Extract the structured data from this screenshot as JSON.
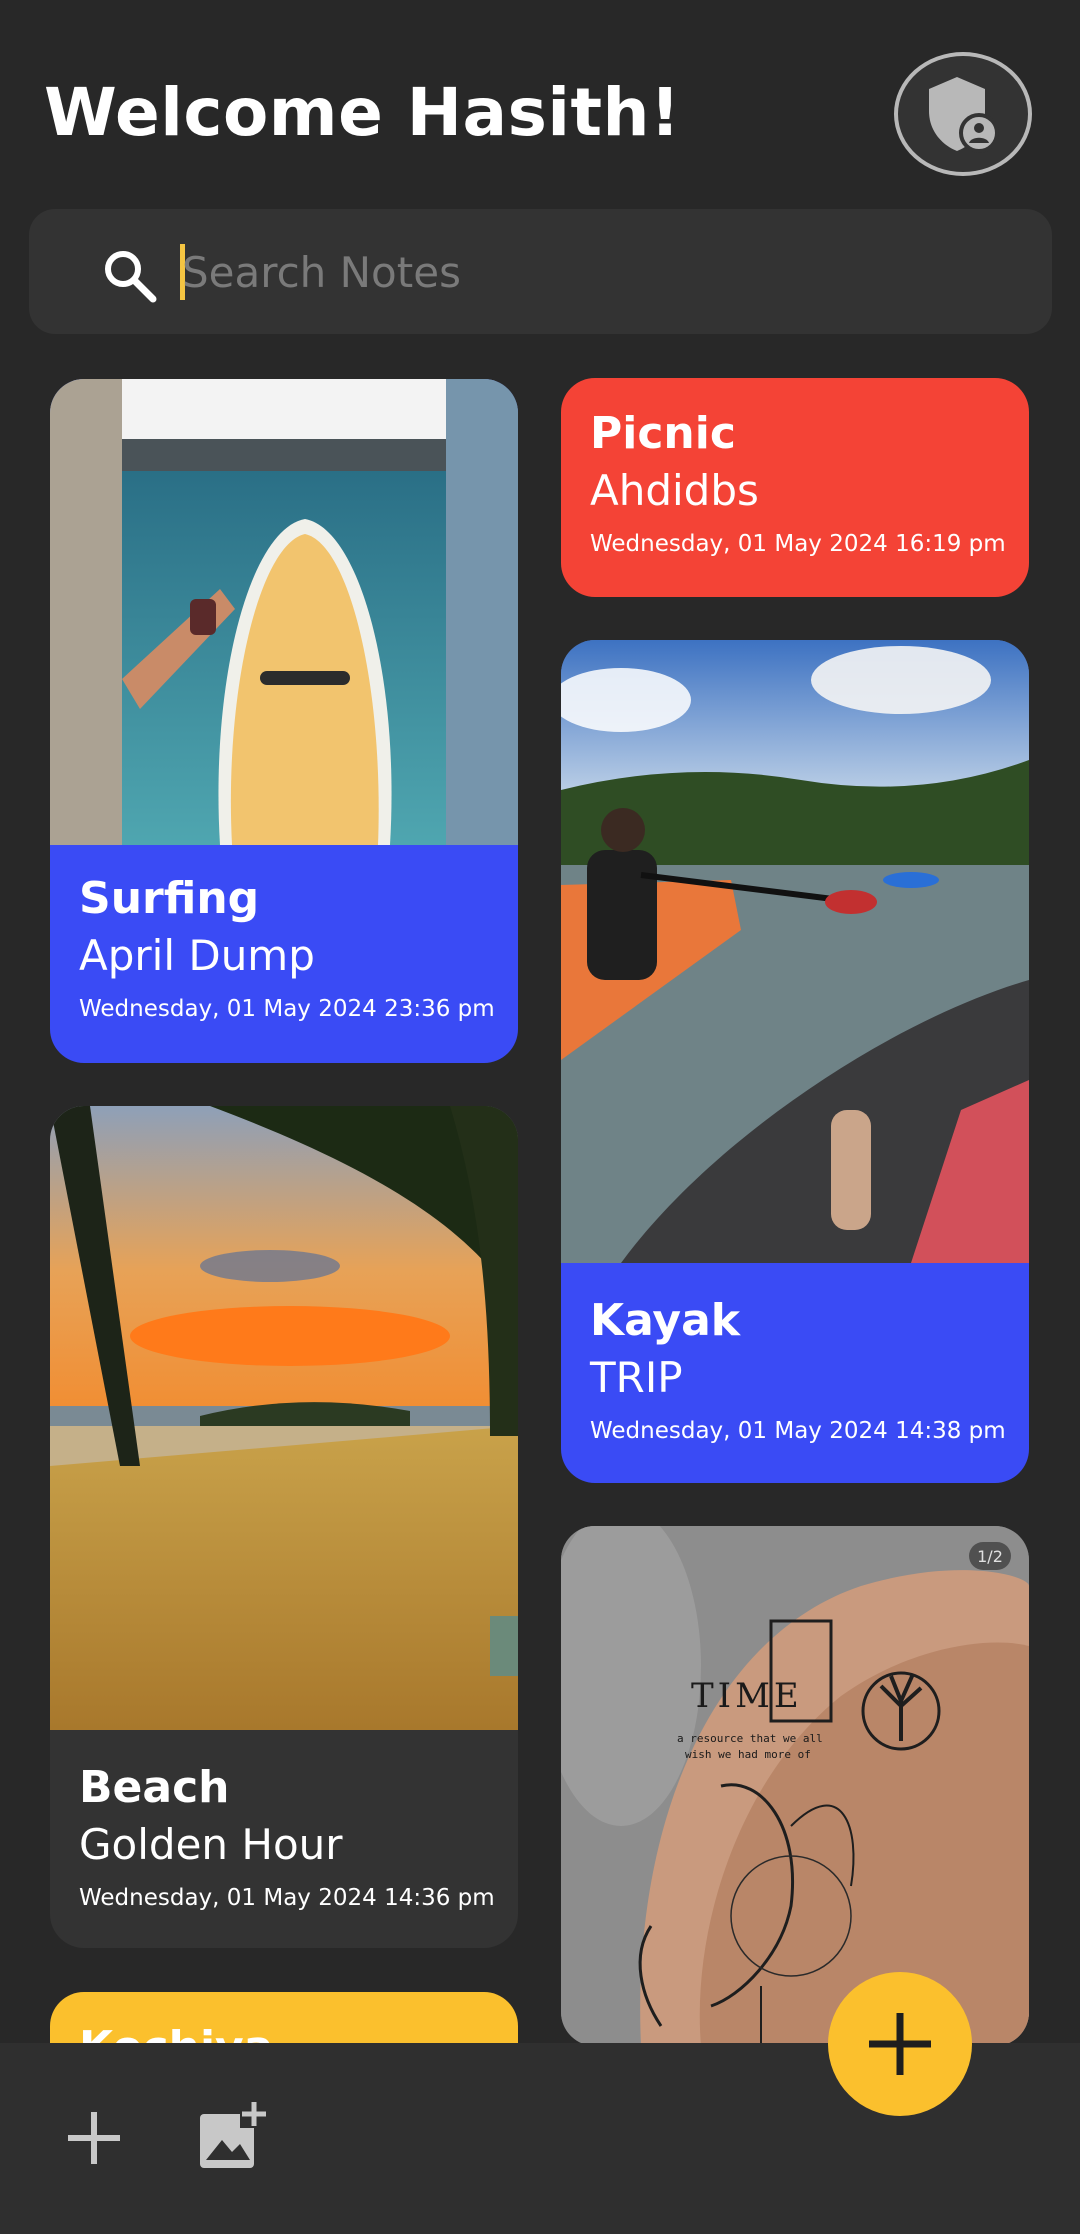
{
  "header": {
    "title": "Welcome Hasith!",
    "profile_icon": "shield-user-icon"
  },
  "search": {
    "placeholder": "Search Notes",
    "value": "",
    "icon": "search-icon"
  },
  "notes": [
    {
      "title": "Surfing",
      "subtitle": "April Dump",
      "date": "Wednesday, 01 May 2024 23:36 pm",
      "color": "#3a4bf5",
      "image": "surfboard-photo"
    },
    {
      "title": "Picnic",
      "subtitle": "Ahdidbs",
      "date": "Wednesday, 01 May 2024 16:19 pm",
      "color": "#f44336"
    },
    {
      "title": "Kayak",
      "subtitle": "TRIP",
      "date": "Wednesday, 01 May 2024 14:38 pm",
      "color": "#3a4bf5",
      "image": "kayak-photo"
    },
    {
      "title": "Beach",
      "subtitle": "Golden Hour",
      "date": "Wednesday, 01 May 2024 14:36 pm",
      "color": "#333333",
      "image": "beach-sunset-photo"
    },
    {
      "title": "Kochiya",
      "color": "#fbc02d"
    },
    {
      "image": "tattoo-photo",
      "badge": "1/2",
      "tattoo_text_1": "TIME",
      "tattoo_text_2": "a resource that we all",
      "tattoo_text_3": "wish we had more of"
    }
  ],
  "bottom_bar": {
    "add_icon": "plus-icon",
    "add_image_icon": "add-image-icon",
    "fab_icon": "plus-icon"
  },
  "colors": {
    "background": "#282828",
    "accent": "#fbc02d",
    "blue_note": "#3a4bf5",
    "red_note": "#f44336"
  }
}
